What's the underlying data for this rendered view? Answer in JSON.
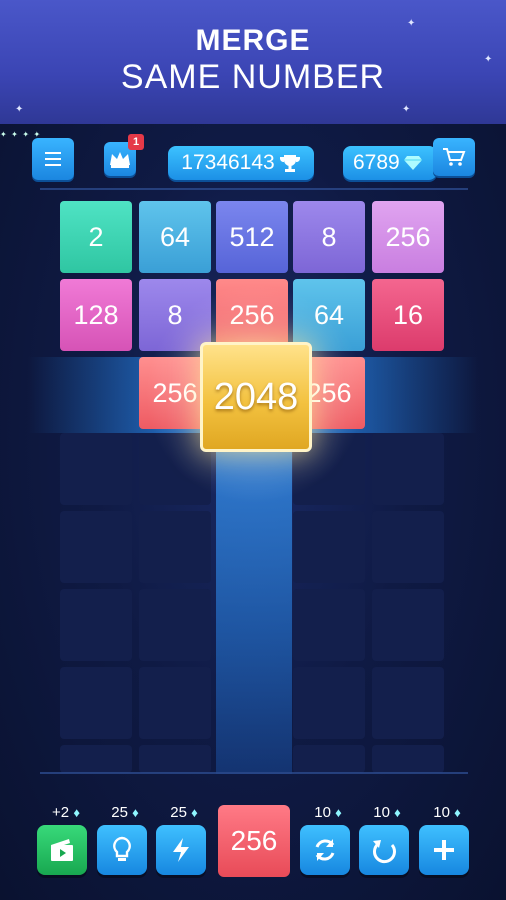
{
  "banner": {
    "line1": "MERGE",
    "line2": "SAME NUMBER"
  },
  "topbar": {
    "menu_icon": "menu-icon",
    "crown_badge": "1",
    "score": "17346143",
    "gems": "6789"
  },
  "board": {
    "row1": [
      "2",
      "64",
      "512",
      "8",
      "256"
    ],
    "row2": [
      "128",
      "8",
      "256",
      "64",
      "16"
    ],
    "row3": [
      "256",
      "2048",
      "256"
    ],
    "colors": {
      "2": "#3fd6b5",
      "64": "#4fb0e0",
      "512": "#6a78e6",
      "8": "#8b78e0",
      "256": "#d78ce8",
      "128": "#e66ac8",
      "16": "#ec4f86",
      "2048": "#f3c240"
    }
  },
  "tools": {
    "video": {
      "cost": "+2",
      "icon": "video-icon"
    },
    "hint": {
      "cost": "25",
      "icon": "lightbulb-icon"
    },
    "bolt": {
      "cost": "25",
      "icon": "lightning-icon"
    },
    "next_tile": "256",
    "swap": {
      "cost": "10",
      "icon": "swap-icon"
    },
    "undo": {
      "cost": "10",
      "icon": "undo-icon"
    },
    "add": {
      "cost": "10",
      "icon": "plus-icon"
    }
  }
}
